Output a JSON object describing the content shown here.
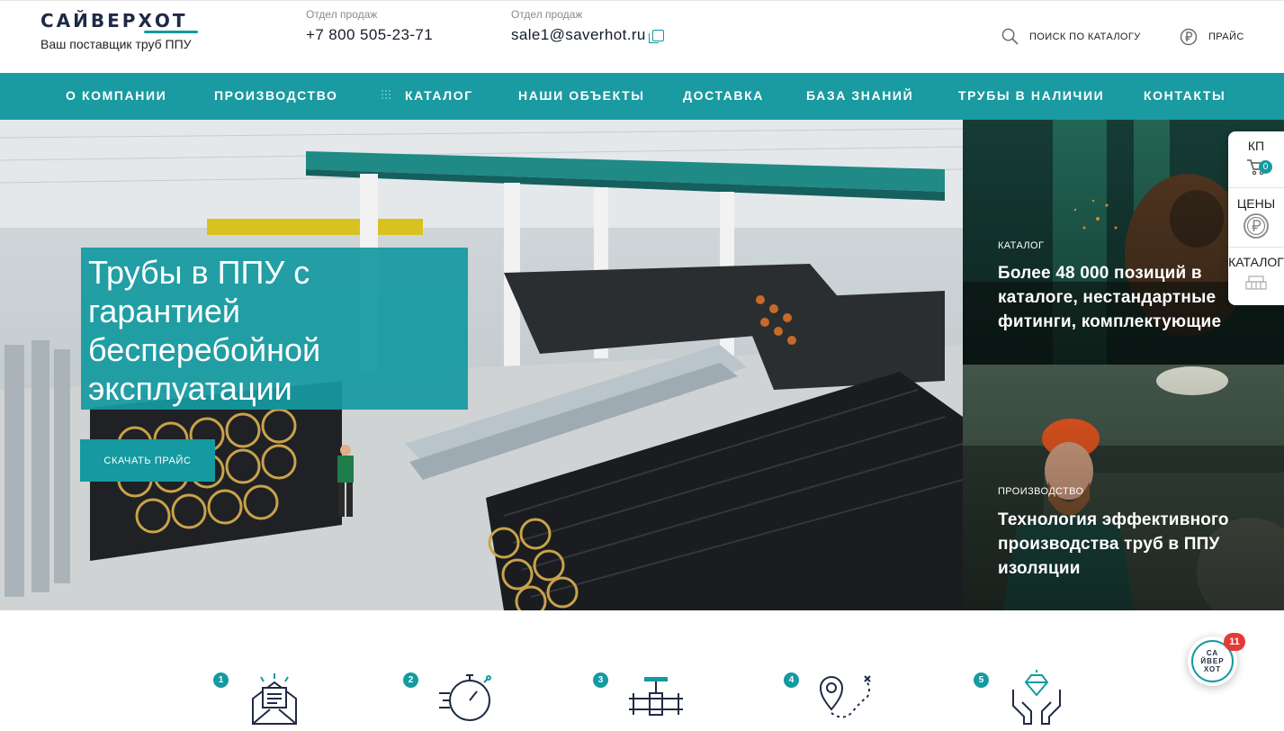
{
  "header": {
    "logo_text": "САЙВЕРХОТ",
    "tagline": "Ваш поставщик труб ППУ",
    "phone_label": "Отдел продаж",
    "phone": "+7 800 505-23-71",
    "email_label": "Отдел продаж",
    "email": "sale1@saverhot.ru",
    "search_label": "ПОИСК ПО КАТАЛОГУ",
    "price_label": "ПРАЙС"
  },
  "nav": {
    "items": [
      {
        "label": "О КОМПАНИИ"
      },
      {
        "label": "ПРОИЗВОДСТВО"
      },
      {
        "label": "КАТАЛОГ"
      },
      {
        "label": "НАШИ ОБЪЕКТЫ"
      },
      {
        "label": "ДОСТАВКА"
      },
      {
        "label": "БАЗА ЗНАНИЙ"
      },
      {
        "label": "ТРУБЫ В НАЛИЧИИ"
      },
      {
        "label": "КОНТАКТЫ"
      }
    ]
  },
  "hero": {
    "title": "Трубы в ППУ с гарантией бесперебойной эксплуатации",
    "button_label": "СКАЧАТЬ ПРАЙС"
  },
  "cards": [
    {
      "kicker": "КАТАЛОГ",
      "title": "Более 48 000 позиций в каталоге, нестандартные фитинги, комплектующие"
    },
    {
      "kicker": "ПРОИЗВОДСТВО",
      "title": "Технология эффективного производства труб в ППУ изоляции"
    }
  ],
  "side_widget": {
    "kp_label": "КП",
    "kp_count": "0",
    "prices_label": "ЦЕНЫ",
    "catalog_label": "КАТАЛОГ"
  },
  "steps": [
    {
      "number": "1",
      "icon": "envelope-document-icon"
    },
    {
      "number": "2",
      "icon": "stopwatch-icon"
    },
    {
      "number": "3",
      "icon": "pipe-valve-icon"
    },
    {
      "number": "4",
      "icon": "map-route-icon"
    },
    {
      "number": "5",
      "icon": "hands-diamond-icon"
    }
  ],
  "chat_widget": {
    "logo_line1": "СА",
    "logo_line2": "ЙВЕР",
    "logo_line3": "ХОТ",
    "unread_count": "11"
  },
  "colors": {
    "accent": "#1a9aa1",
    "dark": "#1f2a44",
    "badge_red": "#e53935"
  }
}
